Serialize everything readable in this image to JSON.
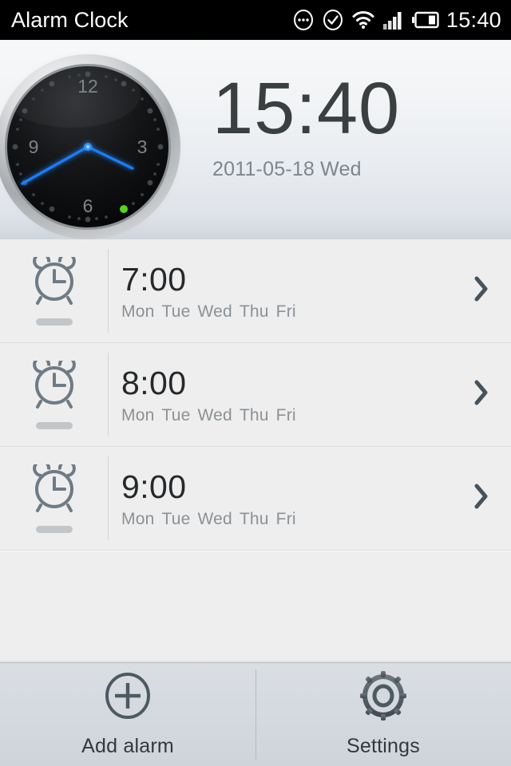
{
  "statusbar": {
    "title": "Alarm Clock",
    "time": "15:40",
    "icons": [
      {
        "name": "notification-ellipsis-icon"
      },
      {
        "name": "check-circle-icon"
      },
      {
        "name": "wifi-icon"
      },
      {
        "name": "signal-bars-icon"
      },
      {
        "name": "battery-icon"
      }
    ]
  },
  "header": {
    "digital_time": "15:40",
    "date": "2011-05-18 Wed",
    "analog": {
      "numerals": [
        "12",
        "3",
        "6",
        "9"
      ],
      "hour_angle_deg": 110,
      "minute_angle_deg": 240,
      "hand_color": "#1f7cf5",
      "face_color": "#0b0b0c",
      "bezel_color": "#b9bcbf",
      "indicator_dot_color": "#55d617"
    }
  },
  "alarms": [
    {
      "time": "7:00",
      "days": [
        "Mon",
        "Tue",
        "Wed",
        "Thu",
        "Fri"
      ],
      "icon": "alarm-clock-icon",
      "chevron": "chevron-right-icon"
    },
    {
      "time": "8:00",
      "days": [
        "Mon",
        "Tue",
        "Wed",
        "Thu",
        "Fri"
      ],
      "icon": "alarm-clock-icon",
      "chevron": "chevron-right-icon"
    },
    {
      "time": "9:00",
      "days": [
        "Mon",
        "Tue",
        "Wed",
        "Thu",
        "Fri"
      ],
      "icon": "alarm-clock-icon",
      "chevron": "chevron-right-icon"
    }
  ],
  "bottom_bar": {
    "add_alarm_label": "Add alarm",
    "settings_label": "Settings"
  },
  "colors": {
    "statusbar_bg": "#000000",
    "header_bg_top": "#f7f8f9",
    "header_bg_bottom": "#cfd5dc",
    "list_bg": "#eeeeee",
    "bottom_bar_bg": "#d4d9df",
    "icon_slate": "#5c6a72",
    "text_primary": "#26292b",
    "text_secondary": "#8b9196"
  }
}
